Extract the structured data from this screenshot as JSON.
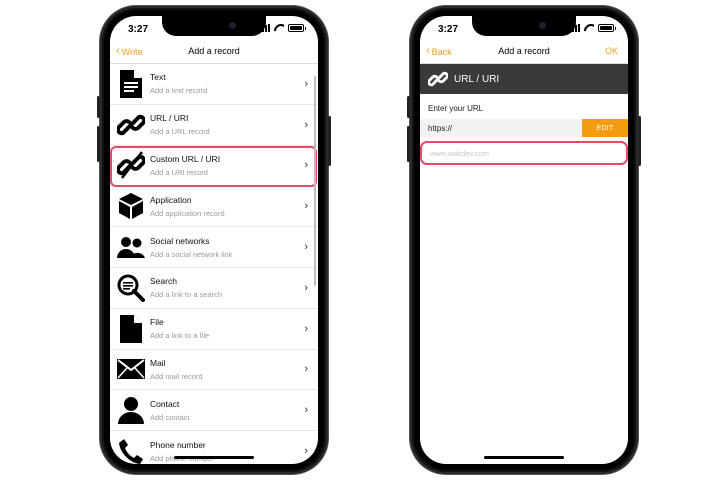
{
  "left_screen": {
    "status_time": "3:27",
    "nav": {
      "back_label": "Write",
      "title": "Add a record"
    },
    "items": [
      {
        "title": "Text",
        "subtitle": "Add a text record",
        "icon": "document-icon"
      },
      {
        "title": "URL / URI",
        "subtitle": "Add a URL record",
        "icon": "link-icon"
      },
      {
        "title": "Custom URL / URI",
        "subtitle": "Add a URI record",
        "icon": "broken-link-icon"
      },
      {
        "title": "Application",
        "subtitle": "Add application record",
        "icon": "cube-icon"
      },
      {
        "title": "Social networks",
        "subtitle": "Add a social network link",
        "icon": "people-icon"
      },
      {
        "title": "Search",
        "subtitle": "Add a link to a search",
        "icon": "magnifier-icon"
      },
      {
        "title": "File",
        "subtitle": "Add a link to a file",
        "icon": "file-icon"
      },
      {
        "title": "Mail",
        "subtitle": "Add mail record",
        "icon": "envelope-icon"
      },
      {
        "title": "Contact",
        "subtitle": "Add contact",
        "icon": "person-icon"
      },
      {
        "title": "Phone number",
        "subtitle": "Add phone number",
        "icon": "phone-icon"
      }
    ]
  },
  "right_screen": {
    "status_time": "3:27",
    "nav": {
      "back_label": "Back",
      "title": "Add a record",
      "ok_label": "OK"
    },
    "header": {
      "title": "URL / URI",
      "icon": "link-icon"
    },
    "enter_label": "Enter your URL",
    "prefix": "https://",
    "edit_label": "EDIT",
    "url_placeholder": "www.wakdev.com"
  },
  "colors": {
    "accent": "#f0a020",
    "edit_button": "#f39c12",
    "highlight": "#e8486a",
    "header_band": "#3a3a3a"
  }
}
